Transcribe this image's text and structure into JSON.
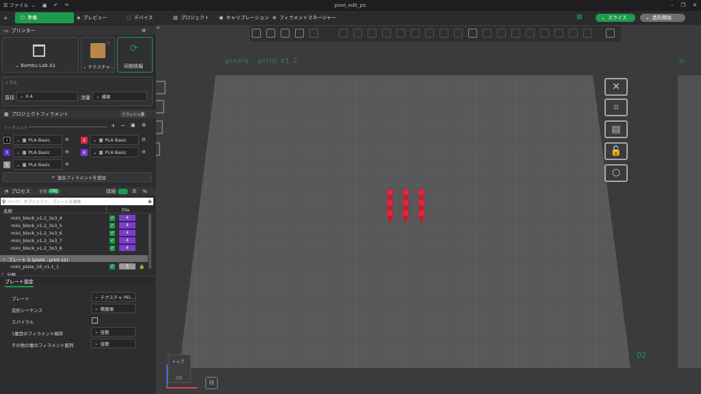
{
  "window": {
    "title": "pixel_edit_pic",
    "menu_label": "ファイル"
  },
  "topbar": {
    "tabs": [
      {
        "label": "準備"
      },
      {
        "label": "プレビュー"
      },
      {
        "label": "デバイス"
      },
      {
        "label": "プロジェクト"
      },
      {
        "label": "キャリブレーション"
      },
      {
        "label": "フィラメントマネージャー"
      }
    ],
    "slice_label": "スライス",
    "print_label": "造形開始"
  },
  "printer": {
    "section_title": "プリンター",
    "printer_name": "Bambu Lab A1",
    "plate_label": "テクスチャ...",
    "sync_label": "同期情報"
  },
  "nozzle": {
    "title": "ノズル",
    "diameter_label": "直径",
    "diameter_value": "0.4",
    "flow_label": "流量",
    "flow_value": "標準"
  },
  "filament": {
    "section_title": "プロジェクトフィラメント",
    "flush_label": "フラッシュ量",
    "filament_label": "フィラメント",
    "slots": [
      {
        "num": "1",
        "name": "PLA Basic",
        "color": "#000000"
      },
      {
        "num": "2",
        "name": "PLA Basic",
        "color": "#e0283a"
      },
      {
        "num": "3",
        "name": "PLA Basic",
        "color": "#5b2fc0"
      },
      {
        "num": "4",
        "name": "PLA Basic",
        "color": "#7d3bd1"
      },
      {
        "num": "5",
        "name": "PLA Basic",
        "color": "#9a9a9a"
      }
    ],
    "add_mixed": "混合フィラメントを追加"
  },
  "process": {
    "section_title": "プロセス",
    "global_label": "全般",
    "obj_label": "OBJ",
    "detail_label": "詳細",
    "search_placeholder": "パーツ、オブジェクト、プレートを検索",
    "col_name": "名称",
    "col_fila": "Fila.",
    "rows": [
      {
        "name": "mini_block_v1.2_3x3_4",
        "fila": "4"
      },
      {
        "name": "mini_block_v1.2_3x3_5",
        "fila": "4"
      },
      {
        "name": "mini_block_v1.2_3x3_6",
        "fila": "4"
      },
      {
        "name": "mini_block_v1.2_3x3_7",
        "fila": "4"
      },
      {
        "name": "mini_block_v1.2_3x3_8",
        "fila": "4"
      }
    ],
    "plate_row": "プレート 5 (plate - print x1)",
    "plate_item": {
      "name": "mini_plate_16_v1.1_1",
      "fila": "5"
    },
    "other_row": "分類"
  },
  "plate_settings": {
    "tab": "プレート設定",
    "rows": [
      {
        "label": "プレート",
        "value": "テクスチャ PEI..."
      },
      {
        "label": "造形シーケンス",
        "value": "積層順"
      },
      {
        "label": "スパイラル",
        "value": ""
      },
      {
        "label": "1層目のフィラメント順序",
        "value": "自動"
      },
      {
        "label": "その他の層のフィラメント配列",
        "value": "自動"
      }
    ]
  },
  "viewport": {
    "plate_title": "pixels - print x1 2",
    "plate_number": "02",
    "view_cube": {
      "top": "トップ",
      "front": "正面"
    },
    "accent": "#1c9b4d",
    "model_color": "#e0283a"
  }
}
